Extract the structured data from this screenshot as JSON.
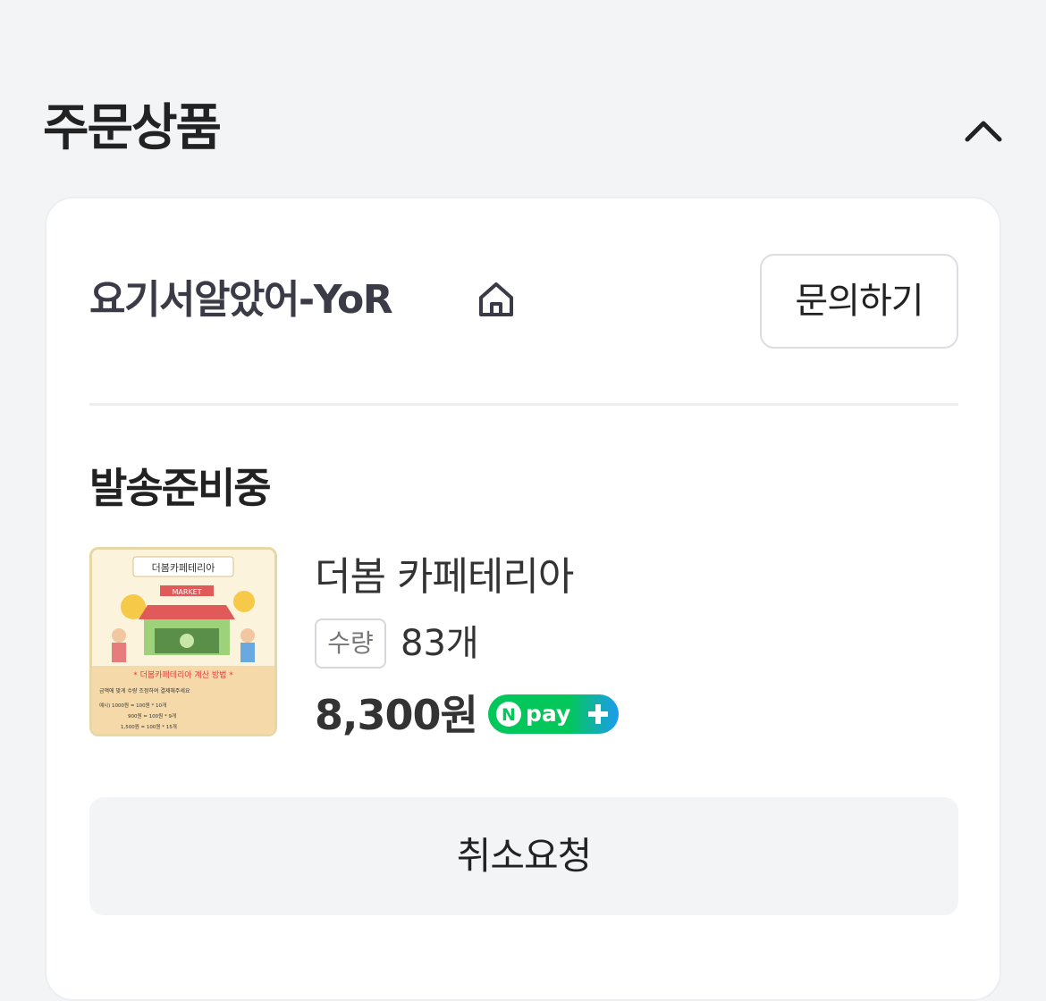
{
  "section": {
    "title": "주문상품"
  },
  "seller": {
    "name": "요기서알았어-YoR",
    "inquiry_label": "문의하기"
  },
  "order": {
    "status": "발송준비중",
    "product": {
      "name": "더봄 카페테리아",
      "quantity_label": "수량",
      "quantity_value": "83개",
      "price": "8,300원",
      "pay_badge": "Npay+",
      "thumbnail_text": {
        "banner": "더봄카페테리아",
        "market": "MARKET",
        "headline": "* 더봄카페테리아 계산 방법 *",
        "line1": "금액에 맞게 수량 조정하여 결제해주세요",
        "line2": "예시) 1000원 = 100원 * 10개",
        "line3": "900원 = 100원 * 9개",
        "line4": "1,500원 = 100원 * 15개"
      }
    },
    "cancel_label": "취소요청"
  },
  "colors": {
    "npay_green": "#03c75a",
    "npay_blue": "#1e9bf0",
    "accent_text": "#222222"
  }
}
